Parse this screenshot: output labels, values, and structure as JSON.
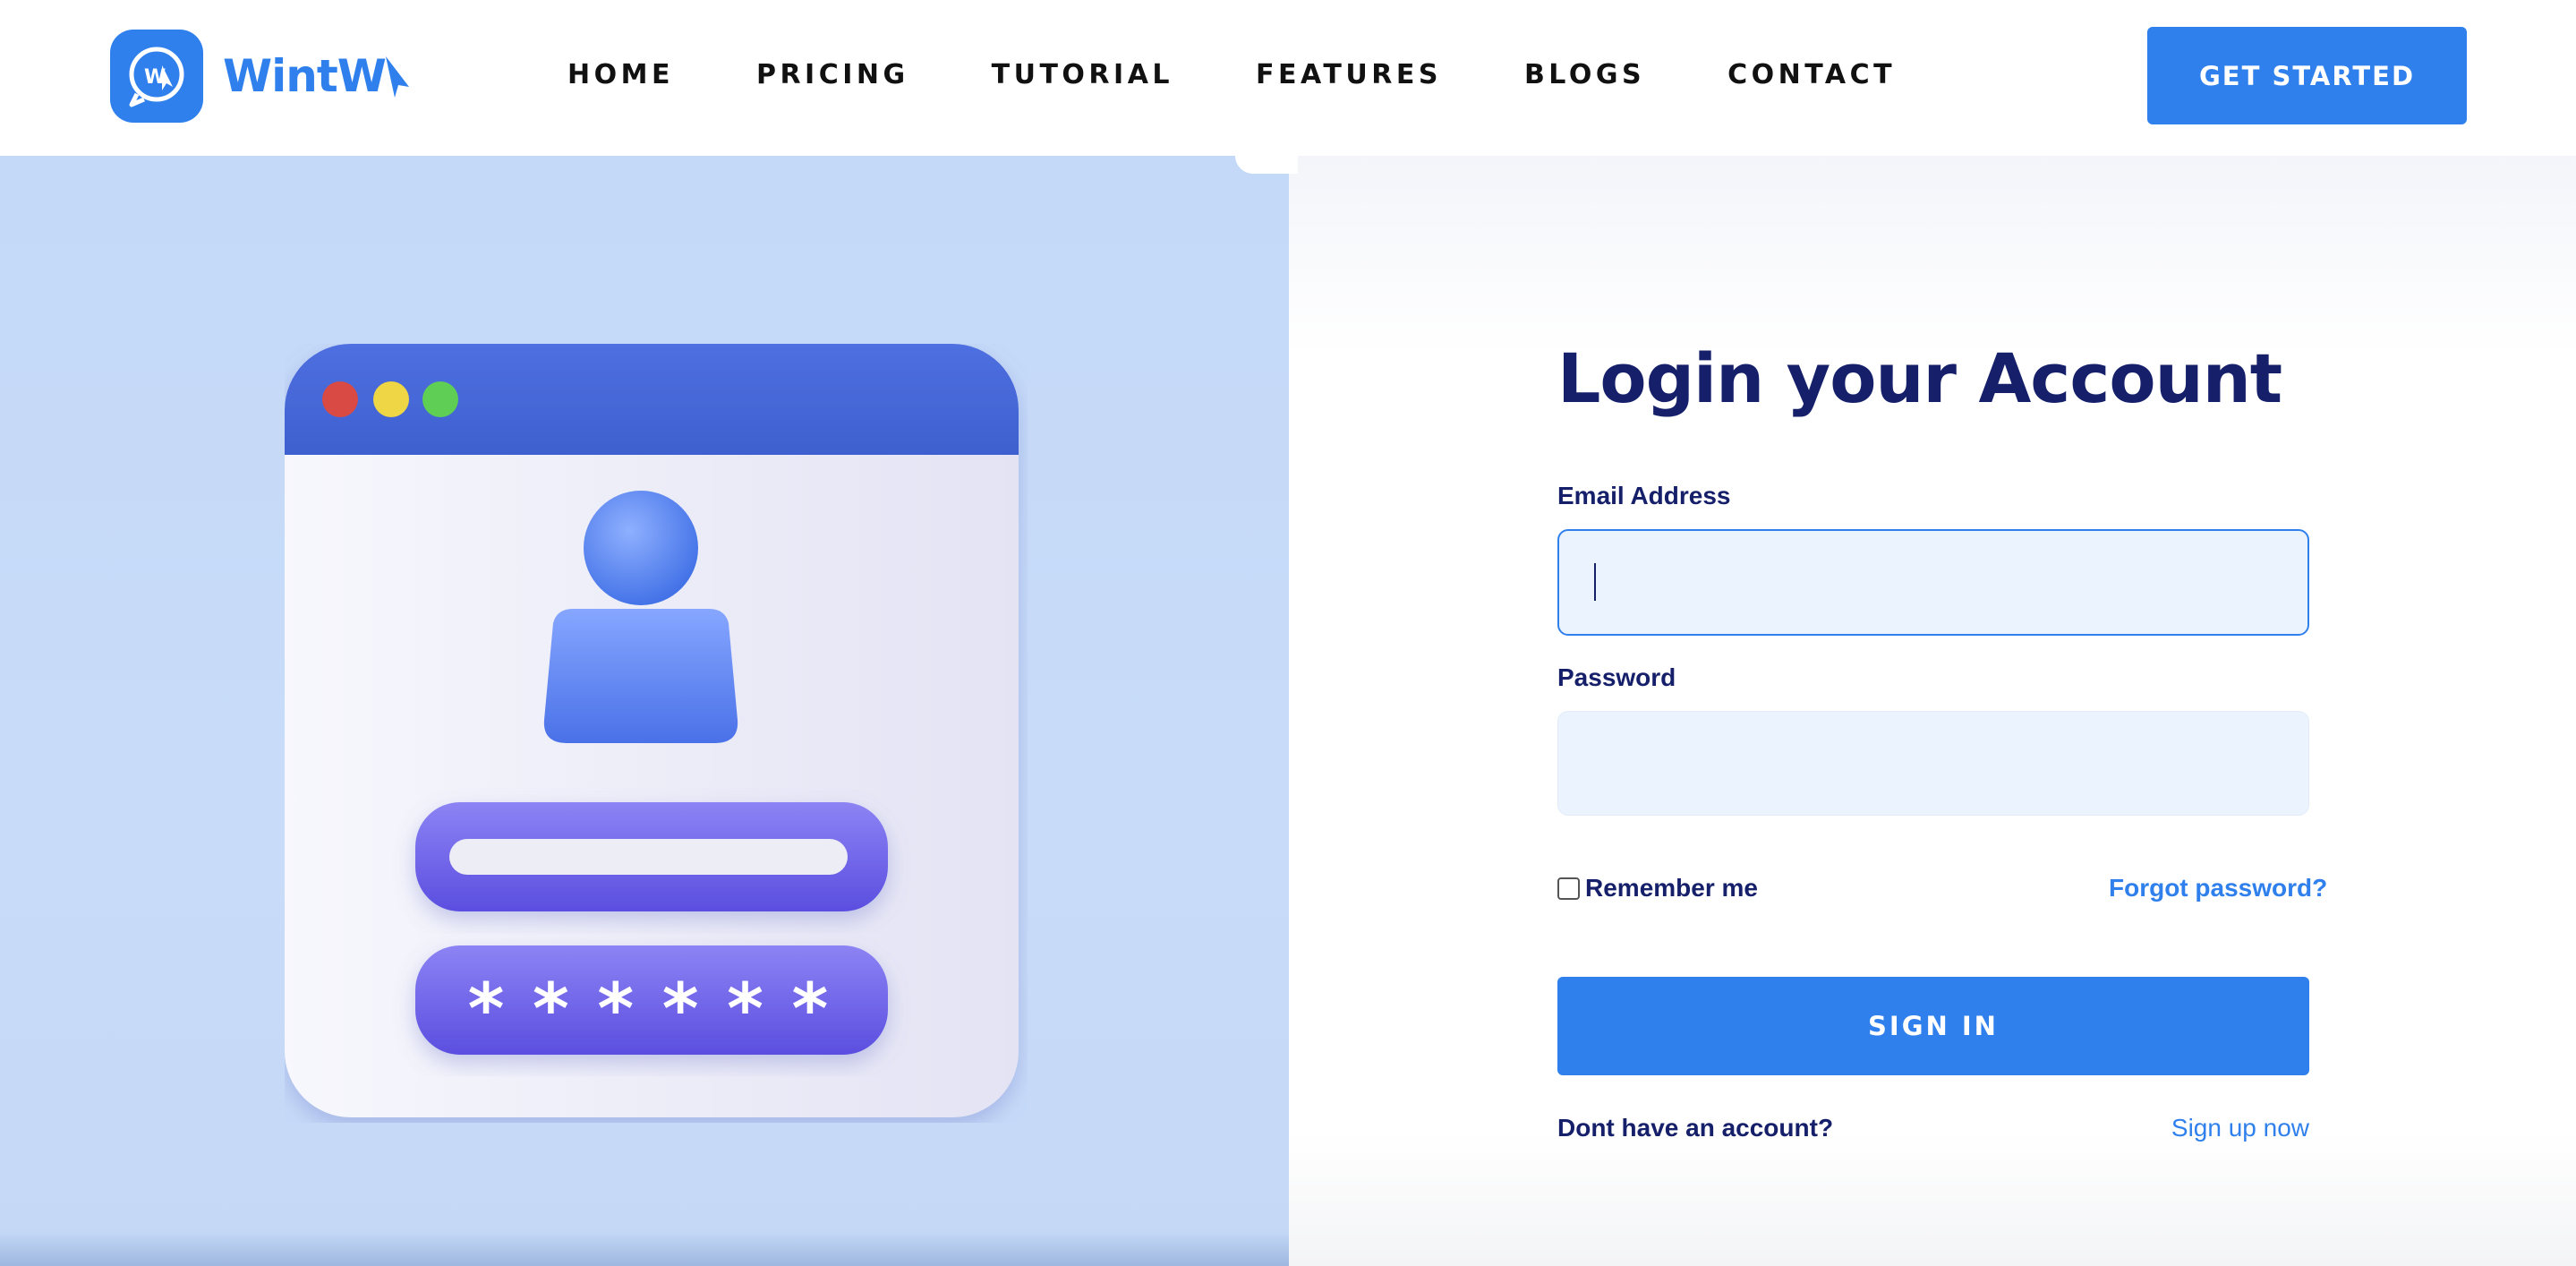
{
  "header": {
    "logo_text": "WintW",
    "logo_badge_text": "W",
    "nav": [
      "HOME",
      "PRICING",
      "TUTORIAL",
      "FEATURES",
      "BLOGS",
      "CONTACT"
    ],
    "cta_label": "GET STARTED"
  },
  "login": {
    "title": "Login your Account",
    "email_label": "Email Address",
    "email_value": "",
    "password_label": "Password",
    "password_value": "",
    "remember_label": "Remember me",
    "remember_checked": false,
    "forgot_label": "Forgot password?",
    "signin_label": "SIGN IN",
    "no_account_text": "Dont have an account?",
    "signup_label": "Sign up now"
  },
  "illustration": {
    "password_mask": "******"
  },
  "colors": {
    "brand": "#2f80ed",
    "heading": "#16206a",
    "left_bg": "#c6daf8",
    "input_bg": "#ebf4fe"
  }
}
